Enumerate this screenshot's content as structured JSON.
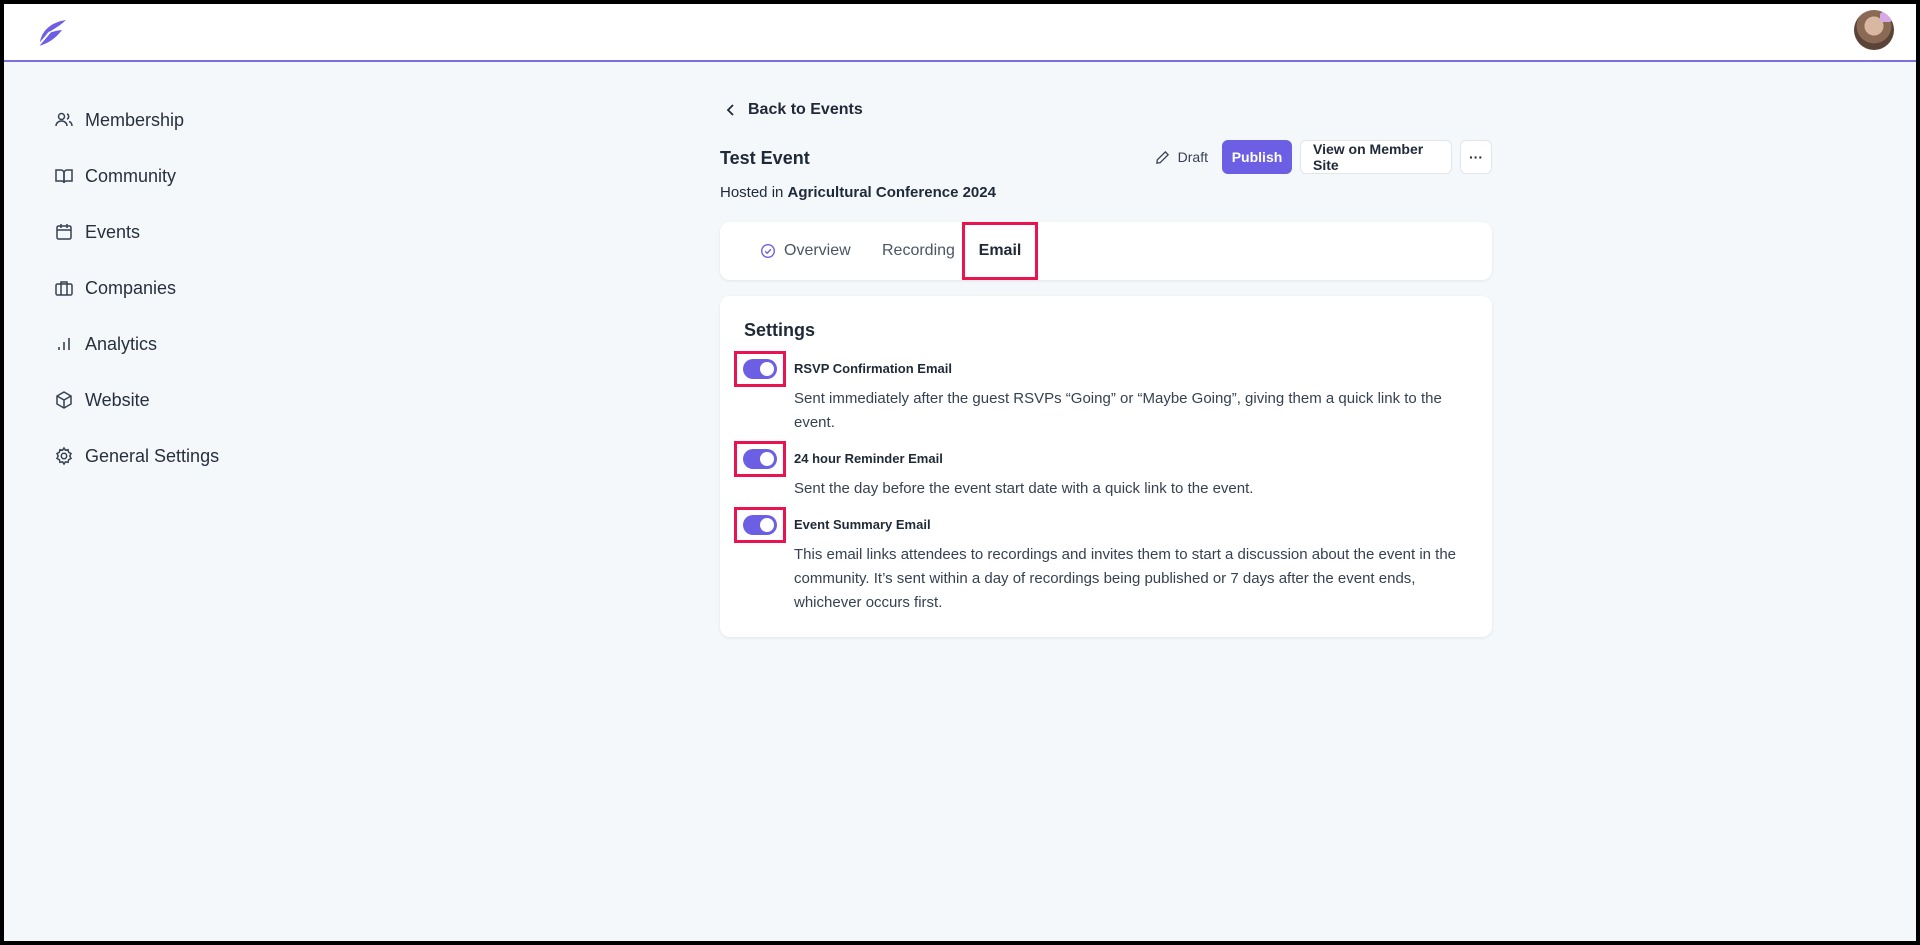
{
  "nav": {
    "items": [
      {
        "label": "Membership",
        "icon": "users-icon"
      },
      {
        "label": "Community",
        "icon": "book-icon"
      },
      {
        "label": "Events",
        "icon": "calendar-icon"
      },
      {
        "label": "Companies",
        "icon": "briefcase-icon"
      },
      {
        "label": "Analytics",
        "icon": "bar-chart-icon"
      },
      {
        "label": "Website",
        "icon": "cube-icon"
      },
      {
        "label": "General Settings",
        "icon": "gear-icon"
      }
    ]
  },
  "header": {
    "back_label": "Back to Events",
    "event_title": "Test Event",
    "draft_label": "Draft",
    "publish_label": "Publish",
    "view_site_label": "View on Member Site",
    "more_label": "···",
    "hosted_prefix": "Hosted in",
    "hosted_name": "Agricultural Conference 2024"
  },
  "tabs": [
    {
      "label": "Overview"
    },
    {
      "label": "Recording"
    },
    {
      "label": "Email"
    }
  ],
  "settings": {
    "title": "Settings",
    "items": [
      {
        "label": "RSVP Confirmation Email",
        "description": "Sent immediately after the guest RSVPs “Going” or “Maybe Going”, giving them a quick link to the event.",
        "enabled": true
      },
      {
        "label": "24 hour Reminder Email",
        "description": "Sent the day before the event start date with a quick link to the event.",
        "enabled": true
      },
      {
        "label": "Event Summary Email",
        "description": "This email links attendees to recordings and invites them to start a discussion about the event in the community. It’s sent within a day of recordings being published or 7 days after the event ends, whichever occurs first.",
        "enabled": true
      }
    ]
  },
  "colors": {
    "accent": "#6d5fe3",
    "highlight": "#e8134f",
    "background": "#f5f8fb"
  }
}
